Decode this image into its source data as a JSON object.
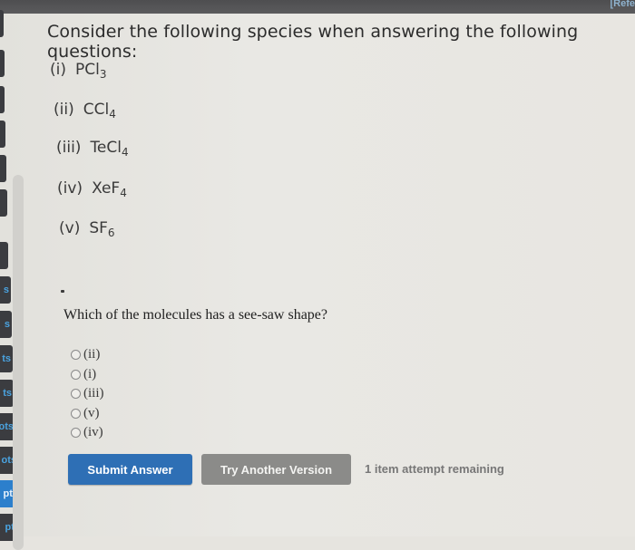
{
  "header": {
    "ref_link": "[Refe"
  },
  "sidenav": {
    "tabs": [
      {
        "label": "",
        "active": false
      },
      {
        "label": "",
        "active": false
      },
      {
        "label": "",
        "active": false
      },
      {
        "label": "s",
        "active": false
      },
      {
        "label": "s",
        "active": false
      },
      {
        "label": "ts",
        "active": false
      },
      {
        "label": "ts",
        "active": false
      },
      {
        "label": "ots",
        "active": false
      },
      {
        "label": "ots",
        "active": false
      },
      {
        "label": "ots",
        "active": false
      },
      {
        "label": "pts",
        "active": true
      },
      {
        "label": "pts",
        "active": false
      }
    ]
  },
  "intro": "Consider the following species when answering the following questions:",
  "species": [
    {
      "num": "(i)",
      "formula": "PCl",
      "sub": "3"
    },
    {
      "num": "(ii)",
      "formula": "CCl",
      "sub": "4"
    },
    {
      "num": "(iii)",
      "formula": "TeCl",
      "sub": "4"
    },
    {
      "num": "(iv)",
      "formula": "XeF",
      "sub": "4"
    },
    {
      "num": "(v)",
      "formula": "SF",
      "sub": "6"
    }
  ],
  "question": {
    "text": "Which of the molecules has a see-saw shape?",
    "options": [
      {
        "label": "(ii)",
        "selected": false
      },
      {
        "label": "(i)",
        "selected": false
      },
      {
        "label": "(iii)",
        "selected": false
      },
      {
        "label": "(v)",
        "selected": false
      },
      {
        "label": "(iv)",
        "selected": false
      }
    ]
  },
  "actions": {
    "submit_label": "Submit Answer",
    "try_another_label": "Try Another Version",
    "attempts_text": "1 item attempt remaining"
  },
  "colors": {
    "submit": "#2e6fb5",
    "try_another": "#8b8b89",
    "nav_active": "#2c7fcc",
    "nav_text": "#4aa3e0"
  }
}
